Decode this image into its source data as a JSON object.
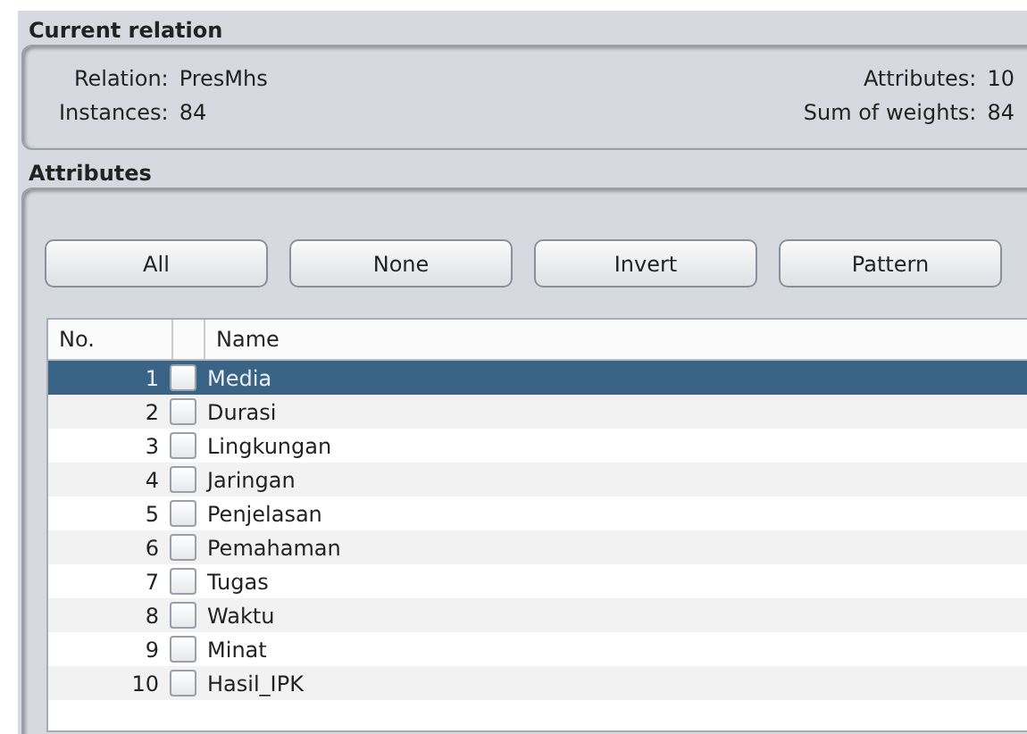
{
  "current_relation": {
    "title": "Current relation",
    "fields": [
      {
        "label": "Relation:",
        "value": "PresMhs"
      },
      {
        "label": "Attributes:",
        "value": "10"
      },
      {
        "label": "Instances:",
        "value": "84"
      },
      {
        "label": "Sum of weights:",
        "value": "84"
      }
    ]
  },
  "attributes": {
    "title": "Attributes",
    "buttons": [
      "All",
      "None",
      "Invert",
      "Pattern"
    ],
    "table": {
      "columns": [
        "No.",
        "Name"
      ],
      "rows": [
        {
          "no": "1",
          "name": "Media",
          "checked": false,
          "selected": true
        },
        {
          "no": "2",
          "name": "Durasi",
          "checked": false,
          "selected": false
        },
        {
          "no": "3",
          "name": "Lingkungan",
          "checked": false,
          "selected": false
        },
        {
          "no": "4",
          "name": "Jaringan",
          "checked": false,
          "selected": false
        },
        {
          "no": "5",
          "name": "Penjelasan",
          "checked": false,
          "selected": false
        },
        {
          "no": "6",
          "name": "Pemahaman",
          "checked": false,
          "selected": false
        },
        {
          "no": "7",
          "name": "Tugas",
          "checked": false,
          "selected": false
        },
        {
          "no": "8",
          "name": "Waktu",
          "checked": false,
          "selected": false
        },
        {
          "no": "9",
          "name": "Minat",
          "checked": false,
          "selected": false
        },
        {
          "no": "10",
          "name": "Hasil_IPK",
          "checked": false,
          "selected": false
        }
      ]
    }
  }
}
